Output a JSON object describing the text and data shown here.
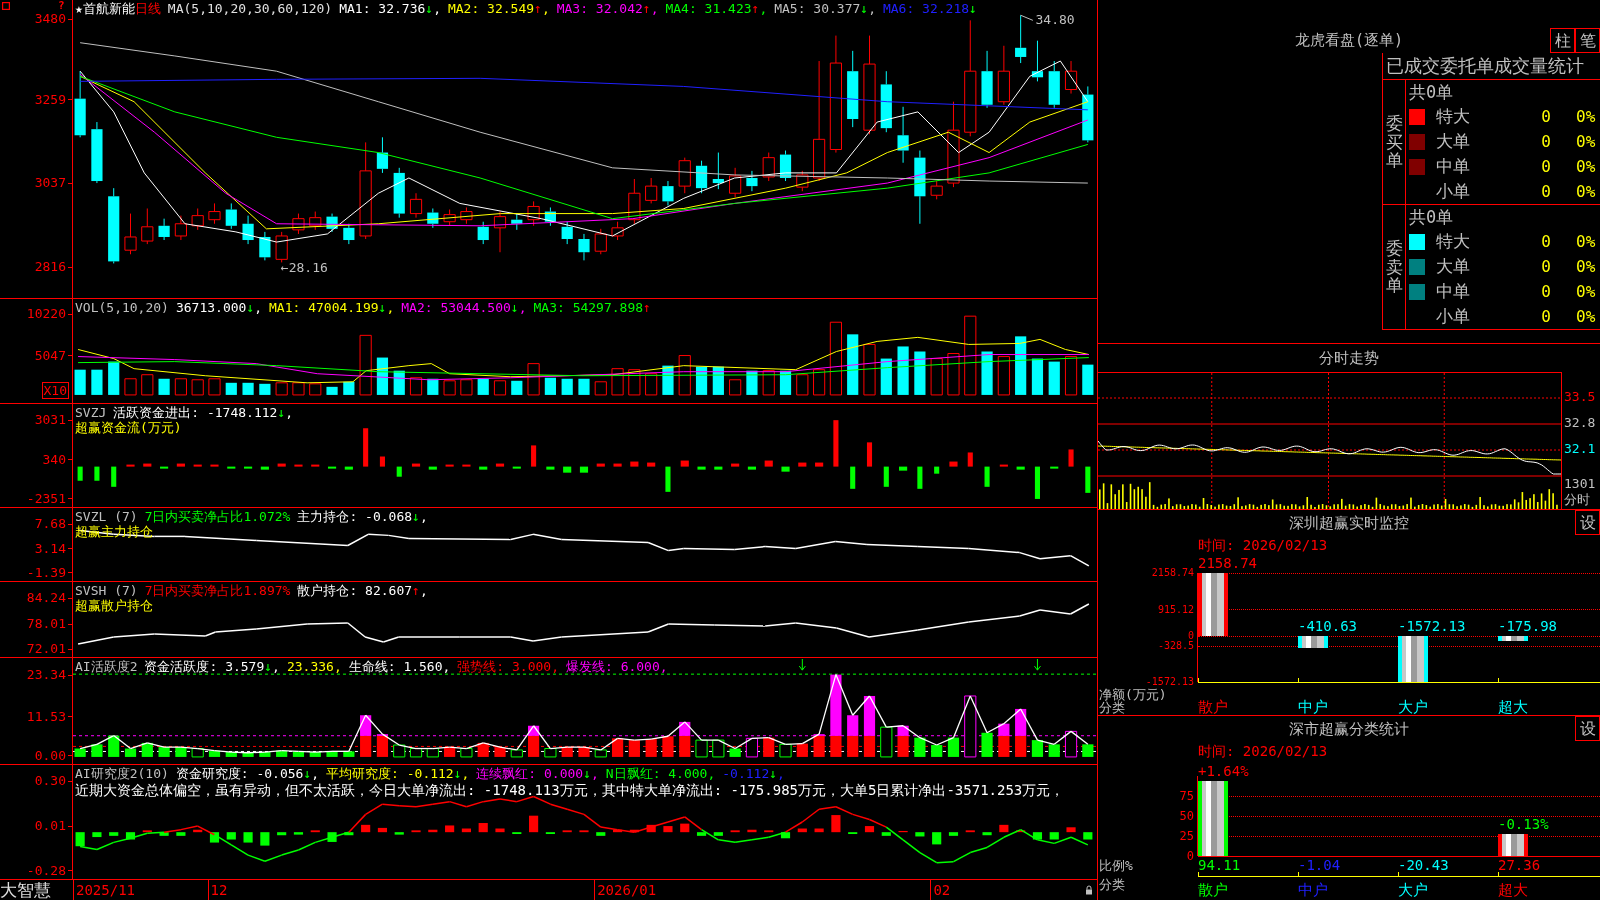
{
  "quote_chart": {
    "help_mark": "?",
    "stock_name": "★首航新能",
    "period": "日线",
    "legend": [
      {
        "label": "MA(5,10,20,30,60,120)",
        "color": "#e0e0e0"
      },
      {
        "label": "MA1: 32.736",
        "color": "#ffffff",
        "arrow": "↓",
        "rising": false,
        "tail": ","
      },
      {
        "label": "MA2: 32.549",
        "color": "#ffff00",
        "arrow": "↑",
        "rising": true,
        "tail": ","
      },
      {
        "label": "MA3: 32.042",
        "color": "#ff00ff",
        "arrow": "↑",
        "rising": true,
        "tail": ","
      },
      {
        "label": "MA4: 31.423",
        "color": "#00ff00",
        "arrow": "↑",
        "rising": true,
        "tail": ","
      },
      {
        "label": "MA5: 30.377",
        "color": "#c0c0c0",
        "arrow": "↓",
        "rising": false,
        "tail": ","
      },
      {
        "label": "MA6: 32.218",
        "color": "#2020ff",
        "arrow": "↓",
        "rising": false
      }
    ],
    "y_labels": [
      "3480",
      "3259",
      "3037",
      "2816"
    ],
    "high_label": "34.80",
    "low_label": "←28.16"
  },
  "volume_panel": {
    "legend": [
      {
        "label": "VOL(5,10,20)",
        "color": "#c0c0c0"
      },
      {
        "label": "36713.000",
        "color": "#ffffff",
        "arrow": "↓",
        "rising": false,
        "tail": ","
      },
      {
        "label": "MA1: 47004.199",
        "color": "#ffff00",
        "arrow": "↓",
        "rising": false,
        "tail": ","
      },
      {
        "label": "MA2: 53044.500",
        "color": "#ff00ff",
        "arrow": "↓",
        "rising": false,
        "tail": ","
      },
      {
        "label": "MA3: 54297.898",
        "color": "#00ff00",
        "arrow": "↑",
        "rising": true
      }
    ],
    "y_labels": [
      "10220",
      "5047"
    ],
    "unit_badge": "X10"
  },
  "fund_flow_panel": {
    "legend": [
      {
        "label": "SVZJ",
        "color": "#c0c0c0"
      },
      {
        "label": "活跃资金进出: -1748.112",
        "color": "#ffffff",
        "arrow": "↓",
        "rising": false,
        "tail": ","
      }
    ],
    "subtitle": "超赢资金流(万元)",
    "y_labels": [
      "3031",
      "340",
      "-2351"
    ]
  },
  "main_force_panel": {
    "legend": [
      {
        "label": "SVZL (7)",
        "color": "#c0c0c0"
      },
      {
        "label": "7日内买卖净占比1.072%",
        "color": "#00ff00"
      },
      {
        "label": "主力持仓: -0.068",
        "color": "#ffffff",
        "arrow": "↓",
        "rising": false,
        "tail": ","
      }
    ],
    "subtitle": "超赢主力持仓",
    "y_labels": [
      "7.68",
      "3.14",
      "-1.39"
    ]
  },
  "retail_panel": {
    "legend": [
      {
        "label": "SVSH (7)",
        "color": "#c0c0c0"
      },
      {
        "label": "7日内买卖净占比1.897%",
        "color": "#ff0000"
      },
      {
        "label": "散户持仓: 82.607",
        "color": "#ffffff",
        "arrow": "↑",
        "rising": true,
        "tail": ","
      }
    ],
    "subtitle": "超赢散户持仓",
    "y_labels": [
      "84.24",
      "78.01",
      "72.01"
    ]
  },
  "activity_panel": {
    "legend": [
      {
        "label": "AI活跃度2",
        "color": "#c0c0c0"
      },
      {
        "label": "资金活跃度: 3.579",
        "color": "#ffffff",
        "arrow": "↓",
        "rising": false,
        "tail": ","
      },
      {
        "label": "23.336",
        "color": "#ffff00",
        "tail": ","
      },
      {
        "label": "生命线: 1.560",
        "color": "#ffffff",
        "tail": ","
      },
      {
        "label": "强势线: 3.000",
        "color": "#ff0000",
        "tail": ","
      },
      {
        "label": "爆发线: 6.000",
        "color": "#ff00ff",
        "tail": ","
      }
    ],
    "y_labels": [
      "23.34",
      "11.53",
      "0.00"
    ]
  },
  "research_panel": {
    "legend": [
      {
        "label": "AI研究度2(10)",
        "color": "#c0c0c0"
      },
      {
        "label": "资金研究度: -0.056",
        "color": "#ffffff",
        "arrow": "↓",
        "rising": false,
        "tail": ","
      },
      {
        "label": "平均研究度: -0.112",
        "color": "#ffff00",
        "arrow": "↓",
        "rising": false,
        "tail": ","
      },
      {
        "label": "连续飘红: 0.000",
        "color": "#ff00ff",
        "arrow": "↓",
        "rising": false,
        "tail": ","
      },
      {
        "label": "N日飘红: 4.000",
        "color": "#00ff00",
        "tail": ","
      },
      {
        "label": "-0.112",
        "color": "#2020ff",
        "arrow": "↓",
        "rising": false,
        "tail": ","
      }
    ],
    "comment": "近期大资金总体偏空，虽有异动，但不太活跃，今日大单净流出: -1748.113万元，其中特大单净流出: -175.985万元，大单5日累计净出-3571.253万元，",
    "y_labels": [
      "0.30",
      "0.01",
      "-0.28"
    ]
  },
  "date_axis": {
    "brand": "大智慧",
    "dates": [
      "2025/11",
      "12",
      "2026/01",
      "02"
    ]
  },
  "order_monitor": {
    "title": "龙虎看盘(逐单)",
    "buttons": [
      "柱",
      "笔"
    ],
    "table_title": "已成交委托单成交量统计",
    "groups": [
      {
        "side_label": "委买单",
        "total": "共0单",
        "rows": [
          {
            "label": "特大",
            "count": "0",
            "share": "0%",
            "color": "#ff0000"
          },
          {
            "label": "大单",
            "count": "0",
            "share": "0%",
            "color": "#800000"
          },
          {
            "label": "中单",
            "count": "0",
            "share": "0%",
            "color": "#800000"
          },
          {
            "label": "小单",
            "count": "0",
            "share": "0%"
          }
        ]
      },
      {
        "side_label": "委卖单",
        "total": "共0单",
        "rows": [
          {
            "label": "特大",
            "count": "0",
            "share": "0%",
            "color": "#00ffff"
          },
          {
            "label": "大单",
            "count": "0",
            "share": "0%",
            "color": "#008080"
          },
          {
            "label": "中单",
            "count": "0",
            "share": "0%",
            "color": "#008080"
          },
          {
            "label": "小单",
            "count": "0",
            "share": "0%"
          }
        ]
      }
    ]
  },
  "intraday": {
    "title": "分时走势",
    "price_labels": [
      {
        "text": "33.5",
        "color": "#ff0000"
      },
      {
        "text": "32.8",
        "color": "#c0c0c0"
      },
      {
        "text": "32.1",
        "color": "#00ffff"
      }
    ],
    "volume_label": "1301",
    "period_label": "分时"
  },
  "realtime_monitor": {
    "title": "深圳超赢实时监控",
    "settings_button": "设",
    "date": "时间: 2026/02/13",
    "category_marks": [
      {
        "color": "#ff0000"
      },
      {
        "color": "#00ffff"
      },
      {
        "color": "#00ffff"
      },
      {
        "color": "#00ffff"
      }
    ],
    "chart_data": {
      "type": "bar",
      "xlabel": "分类",
      "ylabel": "净额(万元)",
      "categories": [
        "散户",
        "中户",
        "大户",
        "超大"
      ],
      "values": [
        2158.74,
        -410.63,
        -1572.13,
        -175.98
      ],
      "ylim": [
        -1572.13,
        2158.74
      ],
      "yticks": [
        2158.74,
        915.12,
        0,
        -328.5,
        -1572.13
      ],
      "grid": true,
      "data_labels": true
    }
  },
  "category_stats": {
    "title": "深市超赢分类统计",
    "settings_button": "设",
    "date": "时间: 2026/02/13",
    "category_marks": [
      {
        "color": "#00ff00"
      },
      {
        "color": "#2020ff"
      },
      {
        "color": "#00ffff"
      },
      {
        "color": "#ff0000"
      }
    ],
    "annotation_marks": [
      {
        "color": "#ff0000"
      },
      {
        "color": "#00ff00"
      }
    ],
    "chart_data": {
      "type": "bar",
      "xlabel": "分类",
      "ylabel": "比例%",
      "categories": [
        "散户",
        "中户",
        "大户",
        "超大"
      ],
      "values": [
        94.11,
        null,
        null,
        27.36
      ],
      "value_labels": [
        "94.11",
        "-1.04",
        "-20.43",
        "27.36"
      ],
      "ylim": [
        0,
        100
      ],
      "yticks": [
        75,
        50,
        25,
        0
      ],
      "grid": true,
      "annotations": [
        {
          "x": "散户",
          "y": 94.11,
          "text": "+1.64%"
        },
        {
          "x": "超大",
          "y": 27.36,
          "text": "-0.13%"
        }
      ]
    }
  }
}
